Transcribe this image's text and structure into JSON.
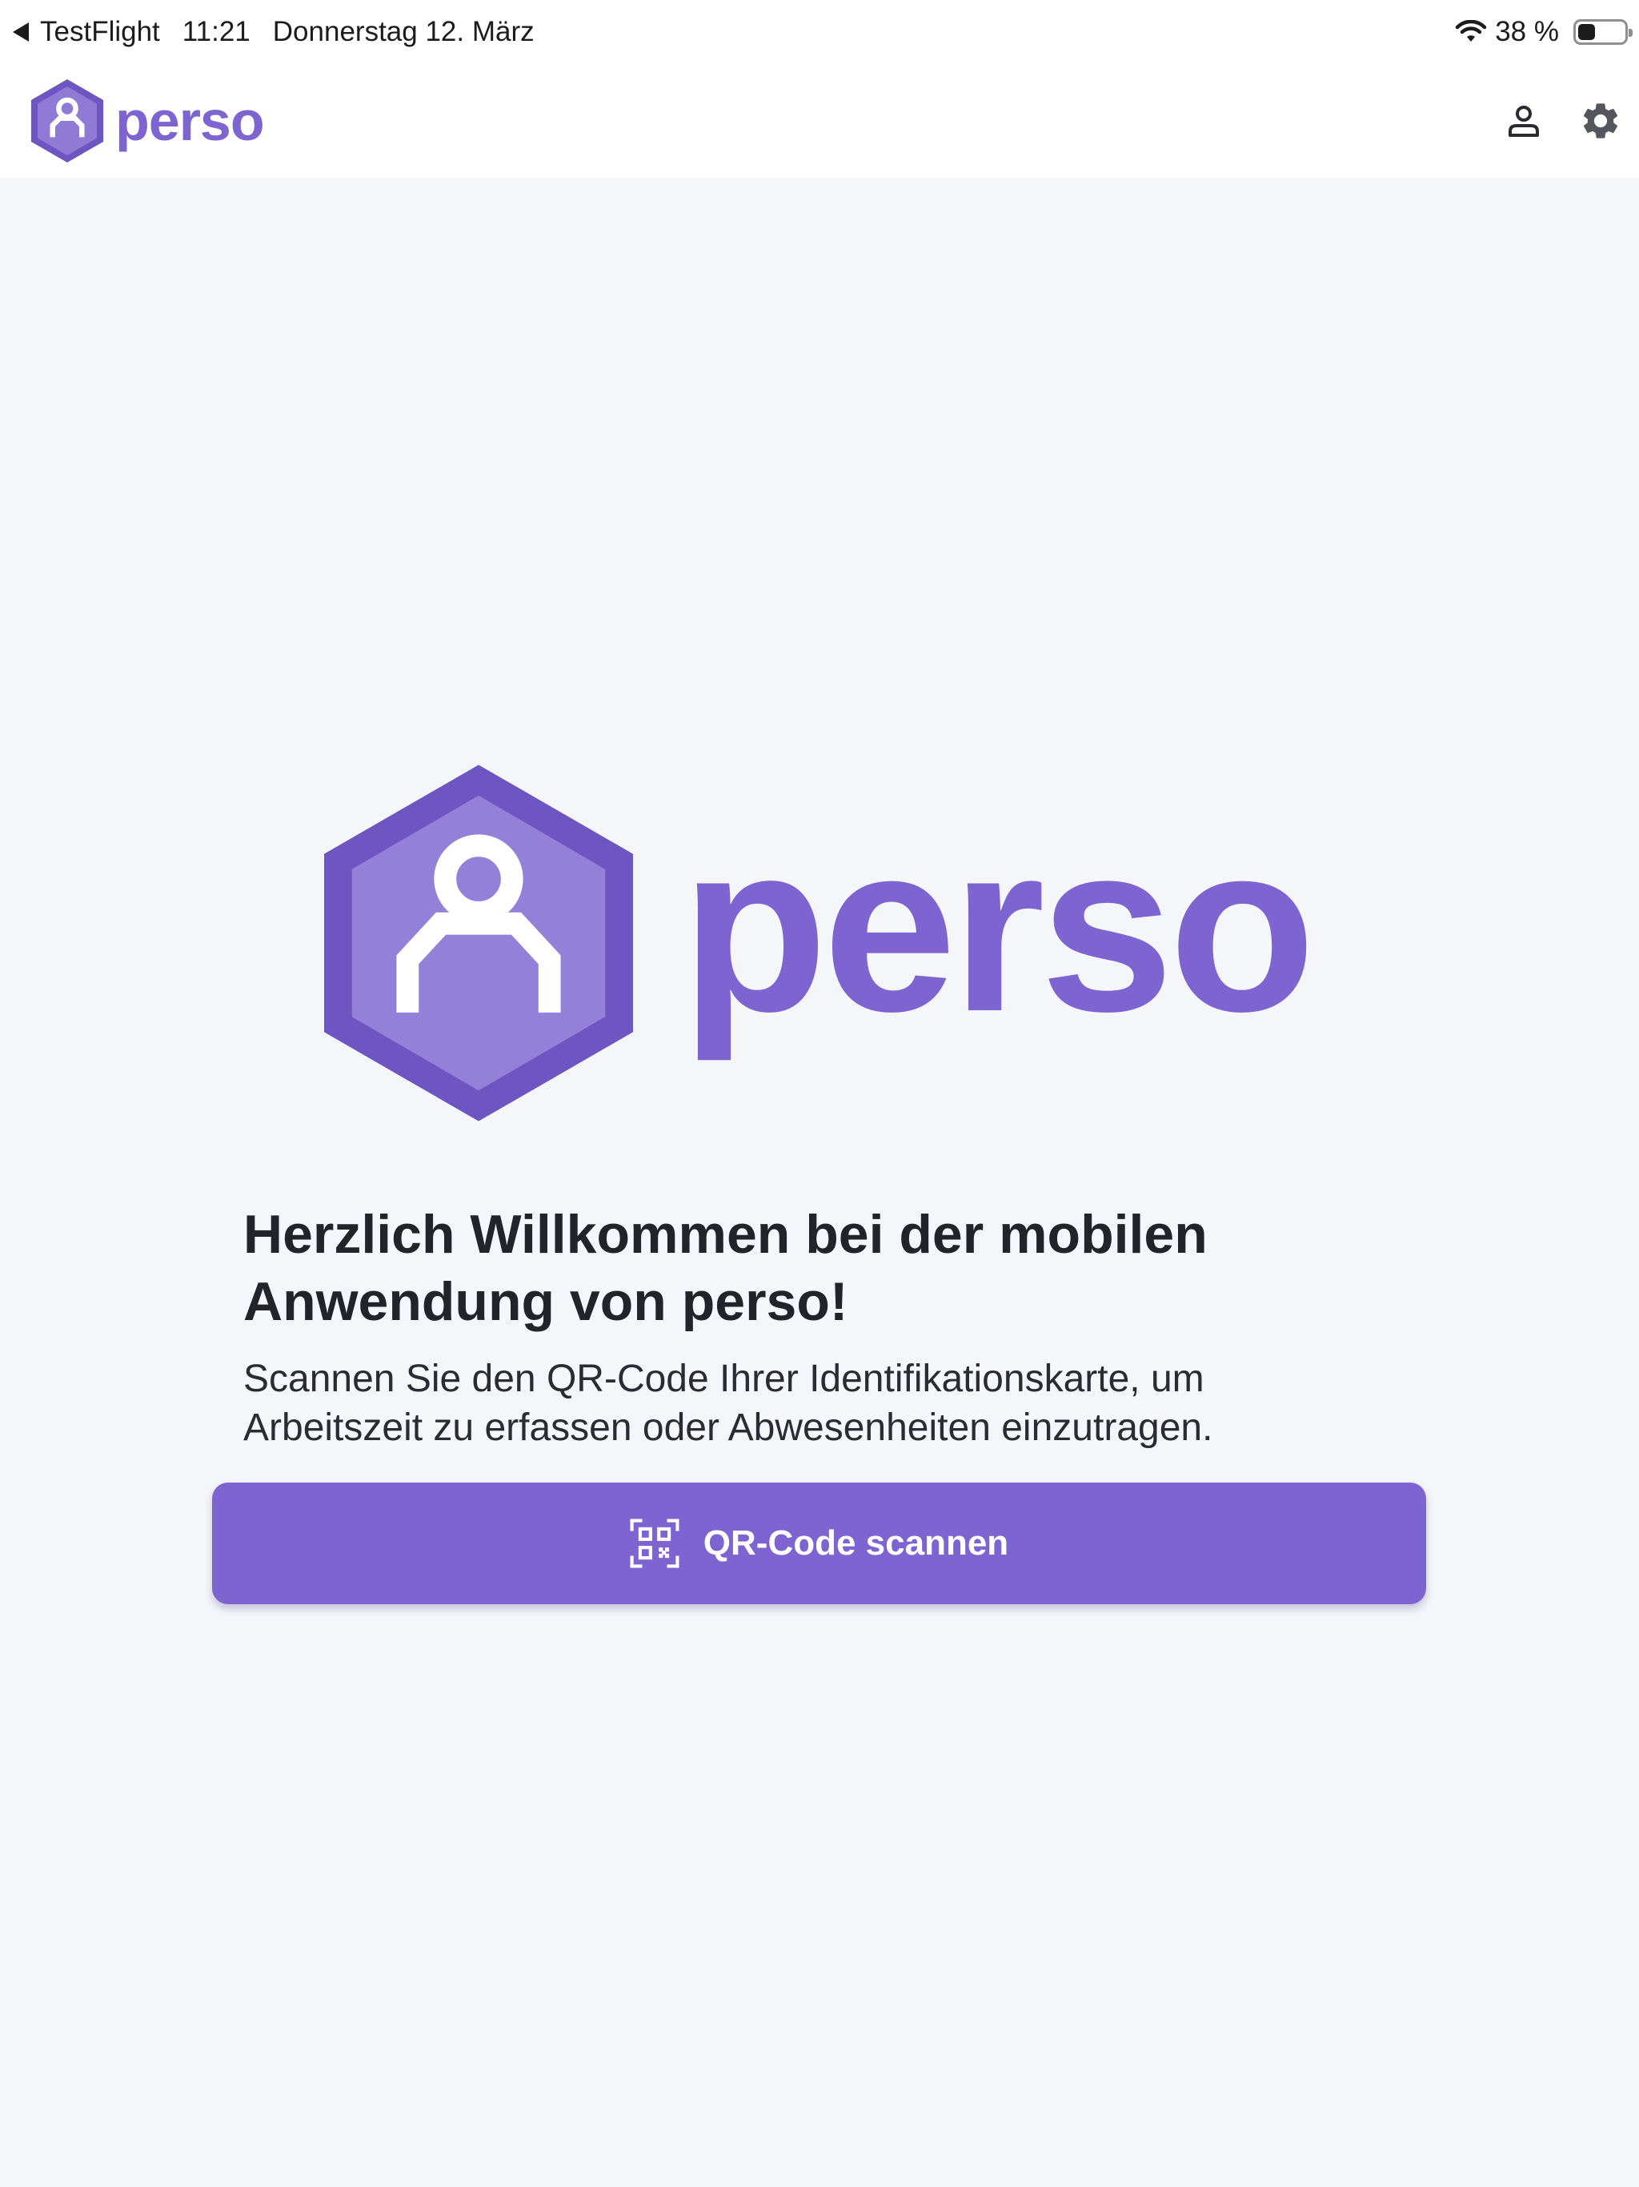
{
  "status_bar": {
    "back_app": "TestFlight",
    "time": "11:21",
    "date": "Donnerstag 12. März",
    "battery_percent": "38 %",
    "battery_level": 0.38
  },
  "header": {
    "brand": "perso",
    "icons": [
      "user-icon",
      "gear-icon"
    ]
  },
  "hero": {
    "brand": "perso"
  },
  "welcome": {
    "title_line1": "Herzlich Willkommen bei der mobilen",
    "title_line2": "Anwendung von perso!",
    "desc_line1": "Scannen Sie den QR-Code Ihrer Identifikationskarte, um",
    "desc_line2": "Arbeitszeit zu erfassen oder Abwesenheiten einzutragen."
  },
  "scan_button": {
    "label": "QR-Code scannen",
    "icon": "qr-code-icon"
  },
  "colors": {
    "accent": "#7d64d0",
    "background": "#f5f6fa",
    "bar": "#ffffff"
  }
}
